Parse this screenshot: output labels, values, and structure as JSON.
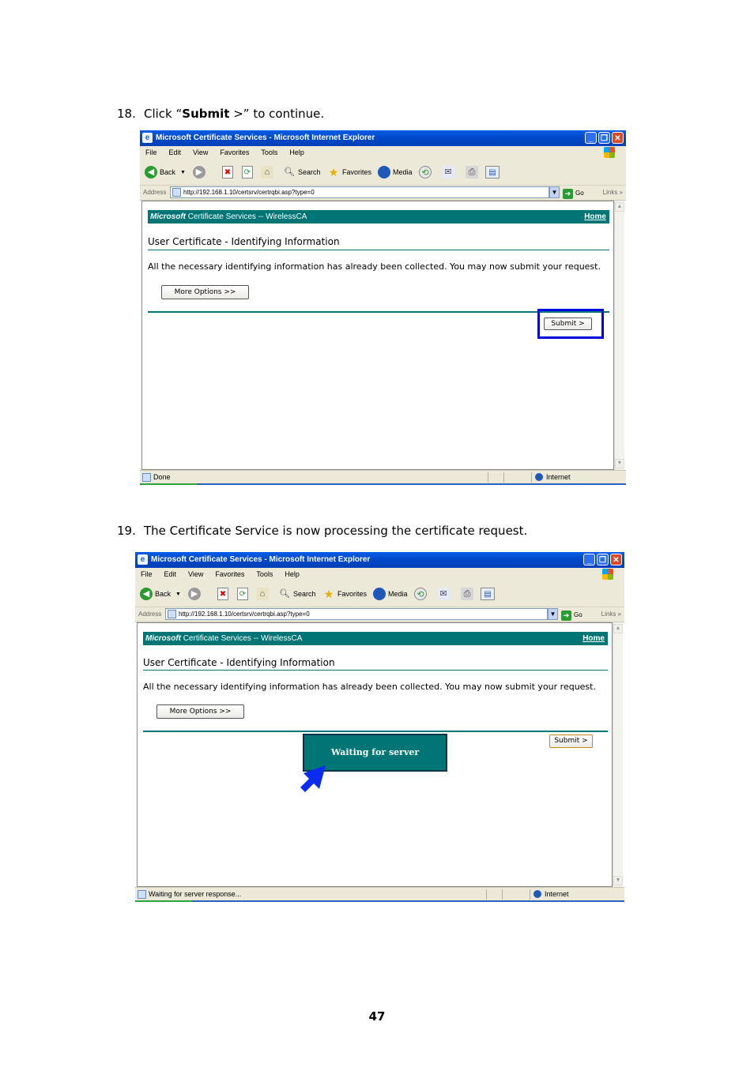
{
  "step18": {
    "number": "18.",
    "prefix": "Click “",
    "bold": "Submit",
    "suffix": " >” to continue."
  },
  "step19": {
    "number": "19.",
    "text": "The Certificate Service is now processing the certificate request."
  },
  "page_number": "47",
  "browser": {
    "title": "Microsoft Certificate Services - Microsoft Internet Explorer",
    "menu": [
      "File",
      "Edit",
      "View",
      "Favorites",
      "Tools",
      "Help"
    ],
    "toolbar": {
      "back": "Back",
      "search": "Search",
      "favorites": "Favorites",
      "media": "Media"
    },
    "address_label": "Address",
    "url": "http://192.168.1.10/certsrv/certrqbi.asp?type=0",
    "go": "Go",
    "links": "Links",
    "zone": "Internet"
  },
  "page": {
    "banner_ms": "Microsoft",
    "banner_rest": " Certificate Services  --  WirelessCA",
    "home": "Home",
    "title": "User Certificate - Identifying Information",
    "message": "All the necessary identifying information has already been collected. You may now submit your request.",
    "more_options": "More Options >>",
    "submit": "Submit >"
  },
  "shot1": {
    "status": "Done"
  },
  "shot2": {
    "status": "Waiting for server response...",
    "wait_box": "Waiting for server response..."
  },
  "colors": {
    "banner": "#007575",
    "highlight": "#0000e0",
    "arrow": "#0a2cf0"
  }
}
